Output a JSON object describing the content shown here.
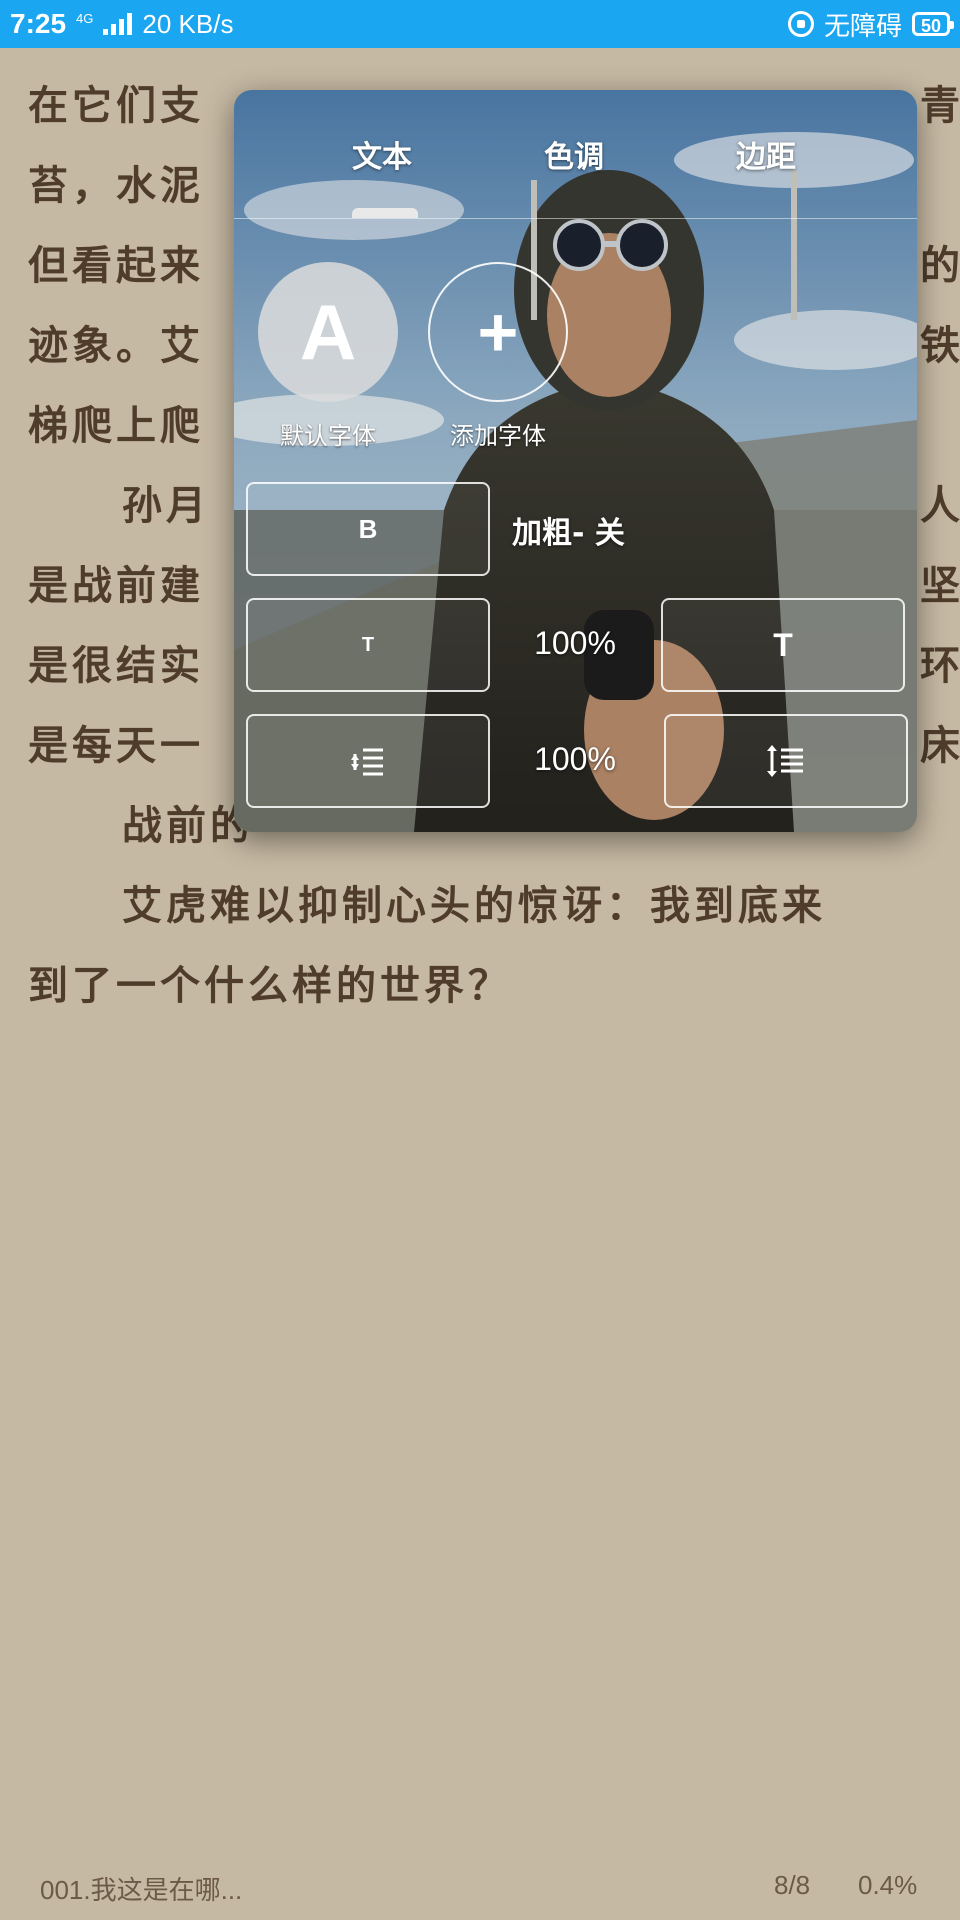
{
  "status_bar": {
    "time": "7:25",
    "network_type": "4G",
    "speed": "20 KB/s",
    "accessibility": "无障碍",
    "battery": "50"
  },
  "reader": {
    "paragraphs": [
      "在它们支撑……苔，水泥……但看起来……迹象。艾……梯爬上爬……",
      "孙月……是战前建……是很结实……是每天一……",
      "战前的",
      "艾虎难以抑制心头的惊讶：我到底来到了一个什么样的世界？"
    ],
    "visible_lines": [
      "在它们支",
      "苔，水泥",
      "但看起来",
      "迹象。艾",
      "梯爬上爬",
      "孙月",
      "是战前建",
      "是很结实",
      "是每天一",
      "战前的",
      "艾虎难以抑制心头的惊讶：我到底来",
      "到了一个什么样的世界？"
    ],
    "right_edge_chars": [
      "青",
      "的",
      "铁",
      "人",
      "坚",
      "环",
      "床"
    ]
  },
  "panel": {
    "tabs": [
      "文本",
      "色调",
      "边距"
    ],
    "active_tab": "文本",
    "fonts": {
      "default_icon": "A",
      "default_label": "默认字体",
      "add_icon": "+",
      "add_label": "添加字体"
    },
    "bold": {
      "button": "B",
      "label": "加粗- 关"
    },
    "font_size": {
      "decrease": "T",
      "value": "100%",
      "increase": "T"
    },
    "line_spacing": {
      "value": "100%",
      "decrease_icon": "line-spacing-decrease-icon",
      "increase_icon": "line-spacing-increase-icon"
    }
  },
  "footer": {
    "chapter": "001.我这是在哪...",
    "page": "8/8",
    "progress": "0.4%"
  }
}
